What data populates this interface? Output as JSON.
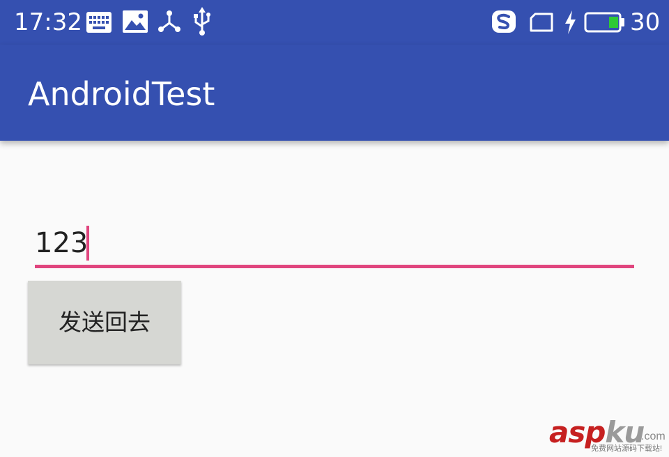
{
  "status_bar": {
    "time": "17:32",
    "icons": [
      "keyboard-icon",
      "image-icon",
      "share-icon",
      "usb-icon",
      "sogou-icon",
      "sim-card-icon",
      "charging-icon",
      "battery-icon"
    ],
    "battery_level": "30",
    "battery_fill_fraction": 0.3,
    "battery_fill_color": "#2ec935"
  },
  "app_bar": {
    "title": "AndroidTest",
    "color": "#3550b0"
  },
  "edit_text": {
    "value": "123",
    "accent_color": "#e0457e"
  },
  "send_button": {
    "label": "发送回去"
  },
  "watermark": {
    "main_red": "asp",
    "main_gray": "ku",
    "domain": ".com",
    "subtitle": "免费网站源码下载站!"
  }
}
